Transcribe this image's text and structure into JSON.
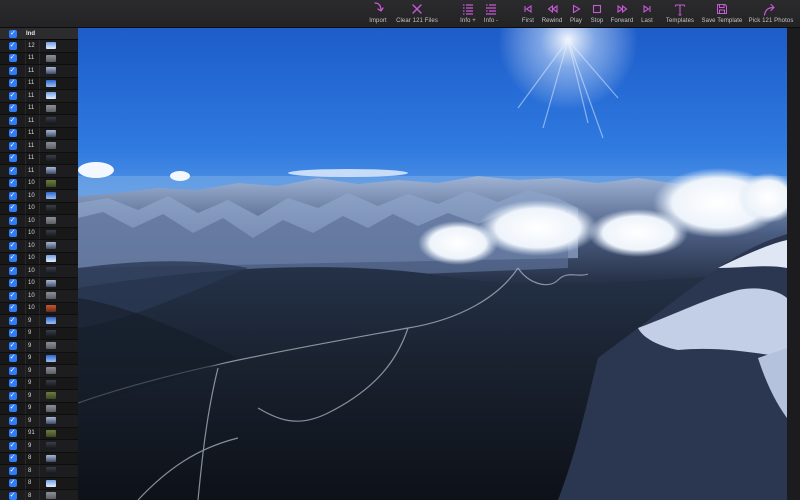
{
  "toolbar": {
    "import": "Import",
    "clear": "Clear 121 Files",
    "info_plus": "Info +",
    "info_minus": "Info -",
    "first": "First",
    "rewind": "Rewind",
    "play": "Play",
    "stop": "Stop",
    "forward": "Forward",
    "last": "Last",
    "templates": "Templates",
    "save_template": "Save Template",
    "pick": "Pick 121 Photos",
    "accent_color": "#c659d6"
  },
  "sidebar": {
    "header_ind": "Ind",
    "checkbox_color": "#2f7cf6",
    "rows": [
      {
        "ind": "12",
        "thumb": "sky"
      },
      {
        "ind": "11",
        "thumb": "grey"
      },
      {
        "ind": "11",
        "thumb": "mountain"
      },
      {
        "ind": "11",
        "thumb": "blue"
      },
      {
        "ind": "11",
        "thumb": "sky"
      },
      {
        "ind": "11",
        "thumb": "grey"
      },
      {
        "ind": "11",
        "thumb": "dark"
      },
      {
        "ind": "11",
        "thumb": "mountain"
      },
      {
        "ind": "11",
        "thumb": "grey"
      },
      {
        "ind": "11",
        "thumb": "dark"
      },
      {
        "ind": "11",
        "thumb": "mountain"
      },
      {
        "ind": "10",
        "thumb": "green"
      },
      {
        "ind": "10",
        "thumb": "blue"
      },
      {
        "ind": "10",
        "thumb": "dark"
      },
      {
        "ind": "10",
        "thumb": "grey"
      },
      {
        "ind": "10",
        "thumb": "dark"
      },
      {
        "ind": "10",
        "thumb": "mountain"
      },
      {
        "ind": "10",
        "thumb": "sky"
      },
      {
        "ind": "10",
        "thumb": "dark"
      },
      {
        "ind": "10",
        "thumb": "mountain"
      },
      {
        "ind": "10",
        "thumb": "grey"
      },
      {
        "ind": "10",
        "thumb": "red"
      },
      {
        "ind": "9",
        "thumb": "blue"
      },
      {
        "ind": "9",
        "thumb": "dark"
      },
      {
        "ind": "9",
        "thumb": "grey"
      },
      {
        "ind": "9",
        "thumb": "blue"
      },
      {
        "ind": "9",
        "thumb": "grey"
      },
      {
        "ind": "9",
        "thumb": "dark"
      },
      {
        "ind": "9",
        "thumb": "green"
      },
      {
        "ind": "9",
        "thumb": "grey"
      },
      {
        "ind": "9",
        "thumb": "mountain"
      },
      {
        "ind": "91",
        "thumb": "green"
      },
      {
        "ind": "9",
        "thumb": "dark"
      },
      {
        "ind": "8",
        "thumb": "mountain"
      },
      {
        "ind": "8",
        "thumb": "dark"
      },
      {
        "ind": "8",
        "thumb": "sky"
      },
      {
        "ind": "8",
        "thumb": "grey"
      },
      {
        "ind": "8",
        "thumb": "dark"
      }
    ]
  }
}
